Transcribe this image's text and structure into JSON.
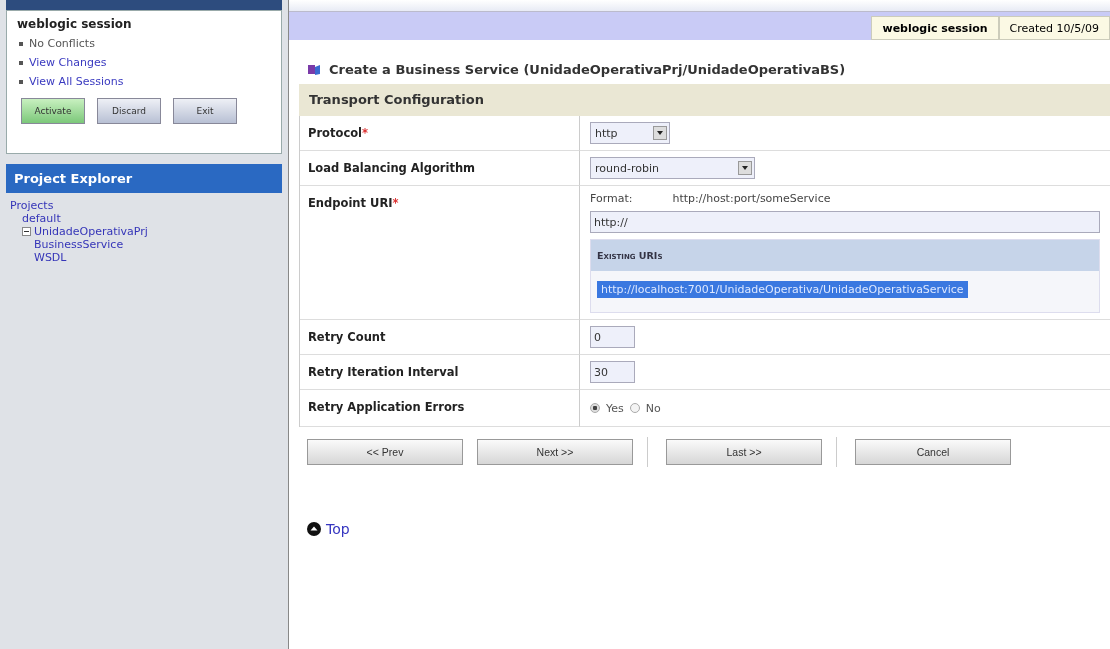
{
  "session": {
    "title": "weblogic session",
    "items": [
      {
        "label": "No Conflicts",
        "link": false
      },
      {
        "label": "View Changes",
        "link": true
      },
      {
        "label": "View All Sessions",
        "link": true
      }
    ],
    "buttons": [
      {
        "label": "Activate",
        "kind": "primary"
      },
      {
        "label": "Discard",
        "kind": "normal"
      },
      {
        "label": "Exit",
        "kind": "normal"
      }
    ]
  },
  "explorer": {
    "title": "Project Explorer",
    "tree": [
      {
        "label": "Projects",
        "children": [
          {
            "label": "default"
          },
          {
            "label": "UnidadeOperativaPrj",
            "expanded": true,
            "children": [
              {
                "label": "BusinessService"
              },
              {
                "label": "WSDL"
              }
            ]
          }
        ]
      }
    ]
  },
  "session_bar": {
    "name": "weblogic session",
    "created": "Created 10/5/09"
  },
  "page": {
    "title": "Create a Business Service (UnidadeOperativaPrj/UnidadeOperativaBS)",
    "section": "Transport Configuration",
    "rows": [
      {
        "kind": "select",
        "label": "Protocol",
        "required_mark": "*",
        "value": "http"
      },
      {
        "kind": "select",
        "label": "Load Balancing Algorithm",
        "value": "round-robin"
      },
      {
        "kind": "uri",
        "label": "Endpoint URI",
        "required_mark": "*",
        "format_label": "Format:",
        "format": "http://host:port/someService",
        "value": "http://",
        "existing_title": "Existing URIs",
        "existing": [
          "http://localhost:7001/UnidadeOperativa/UnidadeOperativaService"
        ]
      },
      {
        "kind": "text",
        "label": "Retry Count",
        "value": "0"
      },
      {
        "kind": "text",
        "label": "Retry Iteration Interval",
        "value": "30"
      },
      {
        "kind": "radio",
        "label": "Retry Application Errors",
        "options": [
          {
            "label": "Yes",
            "selected": true
          },
          {
            "label": "No",
            "selected": false
          }
        ]
      }
    ],
    "buttons": [
      "<< Prev",
      "Next >>",
      "Last >>",
      "Cancel"
    ],
    "top_link": "Top"
  }
}
